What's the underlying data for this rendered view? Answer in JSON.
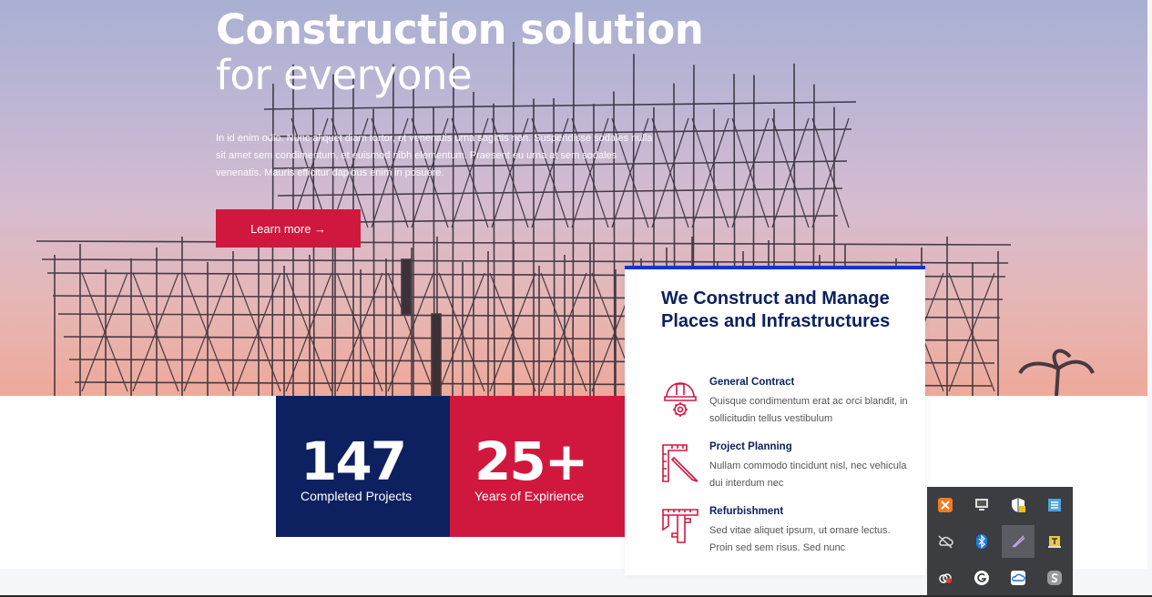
{
  "hero": {
    "title_line1": "Construction solution",
    "title_line2": "for everyone",
    "description": "In id enim odio. Nunc aliquet diam tortor, et venenatis urna sagittis non. Suspendisse sodales nulla sit amet sem condimentum, et euismod nibh elementum. Praesent eu urna at sem sodales venenatis. Mauris efficitur dapibus enim in posuere.",
    "cta_label": "Learn more →"
  },
  "stats": [
    {
      "number": "147",
      "label": "Completed Projects"
    },
    {
      "number": "25+",
      "label": "Years of Expirience"
    }
  ],
  "card": {
    "title": "We Construct and Manage Places and Infrastructures",
    "services": [
      {
        "name": "General Contract",
        "description": "Quisque condimentum erat ac orci blandit, in sollicitudin tellus vestibulum",
        "icon": "helmet-gear-icon"
      },
      {
        "name": "Project Planning",
        "description": "Nullam commodo tincidunt nisl, nec vehicula dui interdum nec",
        "icon": "ruler-pencil-icon"
      },
      {
        "name": "Refurbishment",
        "description": "Sed vitae aliquet ipsum, ut ornare lectus. Proin sed sem risus. Sed nunc",
        "icon": "caliper-icon"
      }
    ]
  },
  "colors": {
    "navy": "#0d2160",
    "red": "#d0183f",
    "card_border": "#1532d6"
  },
  "system_tray": {
    "icons": [
      "xampp-icon",
      "display-icon",
      "shield-warning-icon",
      "network-settings-icon",
      "cloud-off-icon",
      "bluetooth-icon",
      "pen-icon",
      "t-app-icon",
      "creative-cloud-icon",
      "grammarly-icon",
      "onedrive-icon",
      "s-app-icon"
    ]
  }
}
